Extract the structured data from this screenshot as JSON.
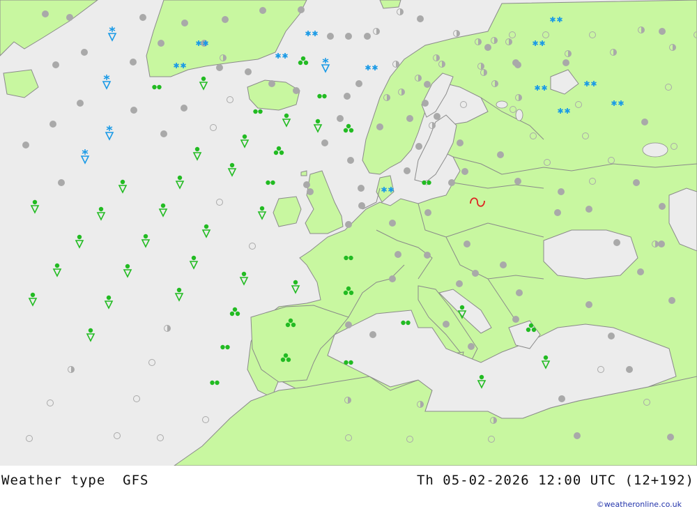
{
  "header": {
    "title": "Weather type",
    "model": "GFS",
    "datetime": "Th 05-02-2026 12:00 UTC (12+192)"
  },
  "credit": "©weatheronline.co.uk",
  "colors": {
    "sea": "#ececec",
    "land": "#c8f7a0",
    "border": "#8a8a8a",
    "cloud": "#a9a9a9",
    "rain": "#22bb22",
    "snow": "#1a9ae6",
    "storm": "#dd2222"
  },
  "legend_symbols": {
    "overcast": "grey filled dot",
    "partly_cloudy": "half-filled circle",
    "clear": "open circle",
    "rain": "green dots",
    "rain_shower": "green shower triangle",
    "snow": "blue asterisks",
    "snow_shower": "blue snow-shower triangle"
  }
}
